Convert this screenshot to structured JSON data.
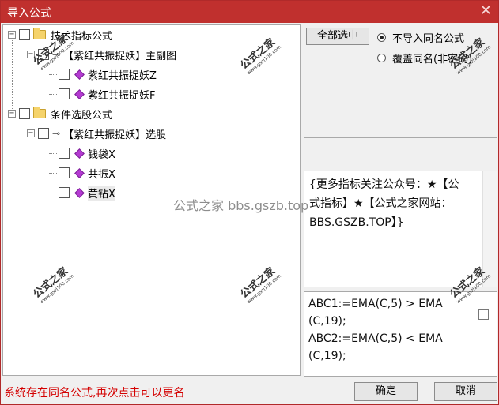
{
  "window": {
    "title": "导入公式",
    "close_glyph": "✕"
  },
  "tree": {
    "nodes": [
      {
        "label": "技术指标公式",
        "type": "folder",
        "expander": "−"
      },
      {
        "label": "【紫红共振捉妖】主副图",
        "type": "group",
        "expander": "−"
      },
      {
        "label": "紫红共振捉妖Z",
        "type": "formula"
      },
      {
        "label": "紫红共振捉妖F",
        "type": "formula"
      },
      {
        "label": "条件选股公式",
        "type": "folder",
        "expander": "−"
      },
      {
        "label": "【紫红共振捉妖】选股",
        "type": "group",
        "expander": "−"
      },
      {
        "label": "钱袋X",
        "type": "formula"
      },
      {
        "label": "共振X",
        "type": "formula"
      },
      {
        "label": "黄钻X",
        "type": "formula"
      }
    ]
  },
  "controls": {
    "select_all": "全部选中",
    "radio_no_import": "不导入同名公式",
    "radio_overwrite": "覆盖同名(非密码)",
    "confirm": "确定",
    "cancel": "取消"
  },
  "description_text": "{更多指标关注公众号：★【公式指标】★【公式之家网站：BBS.GSZB.TOP】}",
  "formula_lines": [
    "ABC1:=EMA(C,5) > EMA",
    "(C,19);",
    "ABC2:=EMA(C,5) < EMA",
    "(C,19);"
  ],
  "status_message": "系统存在同名公式,再次点击可以更名",
  "watermark": {
    "center": "公式之家 bbs.gszb.top",
    "stamp": "公式之家",
    "stamp_url": "www.gszj100.com"
  }
}
